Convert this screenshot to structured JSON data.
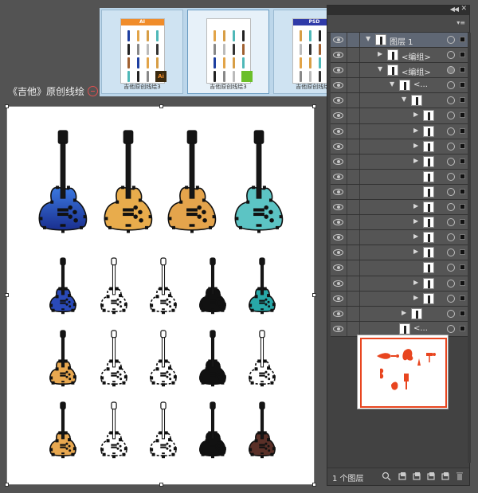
{
  "document": {
    "artboard_title": "《吉他》原创线绘"
  },
  "thumbnails": [
    {
      "label": "吉他原创线绘3",
      "header_text": "AI",
      "header_color": "#f08c2a",
      "badge": "Ai",
      "badge_color": "#f08c2a",
      "selected": false
    },
    {
      "label": "吉他原创线绘3",
      "header_text": "",
      "header_color": "#ffffff",
      "badge": "",
      "badge_color": "#6bbf2a",
      "selected": true
    },
    {
      "label": "吉他原创线绘3",
      "header_text": "PSD",
      "header_color": "#2f3aa8",
      "badge": "",
      "badge_color": "#c93ad0",
      "selected": false
    }
  ],
  "layers_panel": {
    "rows": [
      {
        "name": "图层 1",
        "indent": 0,
        "expanded": true,
        "has_twisty": true,
        "top": true,
        "full_target": false
      },
      {
        "name": "<编组>",
        "indent": 1,
        "expanded": false,
        "has_twisty": true,
        "top": false,
        "full_target": false
      },
      {
        "name": "<编组>",
        "indent": 1,
        "expanded": true,
        "has_twisty": true,
        "top": false,
        "full_target": true
      },
      {
        "name": "<...",
        "indent": 2,
        "expanded": true,
        "has_twisty": true,
        "top": false,
        "full_target": false
      },
      {
        "name": "",
        "indent": 3,
        "expanded": true,
        "has_twisty": true,
        "top": false,
        "full_target": false
      },
      {
        "name": "",
        "indent": 4,
        "expanded": false,
        "has_twisty": true,
        "top": false,
        "full_target": false
      },
      {
        "name": "",
        "indent": 4,
        "expanded": false,
        "has_twisty": true,
        "top": false,
        "full_target": false
      },
      {
        "name": "",
        "indent": 4,
        "expanded": false,
        "has_twisty": true,
        "top": false,
        "full_target": false
      },
      {
        "name": "",
        "indent": 4,
        "expanded": false,
        "has_twisty": true,
        "top": false,
        "full_target": false
      },
      {
        "name": "",
        "indent": 4,
        "expanded": false,
        "has_twisty": false,
        "top": false,
        "full_target": false
      },
      {
        "name": "",
        "indent": 4,
        "expanded": false,
        "has_twisty": false,
        "top": false,
        "full_target": false
      },
      {
        "name": "",
        "indent": 4,
        "expanded": false,
        "has_twisty": true,
        "top": false,
        "full_target": false
      },
      {
        "name": "",
        "indent": 4,
        "expanded": false,
        "has_twisty": true,
        "top": false,
        "full_target": false
      },
      {
        "name": "",
        "indent": 4,
        "expanded": false,
        "has_twisty": true,
        "top": false,
        "full_target": false
      },
      {
        "name": "",
        "indent": 4,
        "expanded": false,
        "has_twisty": true,
        "top": false,
        "full_target": false
      },
      {
        "name": "",
        "indent": 4,
        "expanded": false,
        "has_twisty": false,
        "top": false,
        "full_target": false
      },
      {
        "name": "",
        "indent": 4,
        "expanded": false,
        "has_twisty": true,
        "top": false,
        "full_target": false
      },
      {
        "name": "",
        "indent": 4,
        "expanded": false,
        "has_twisty": true,
        "top": false,
        "full_target": false
      },
      {
        "name": "",
        "indent": 3,
        "expanded": false,
        "has_twisty": true,
        "top": false,
        "full_target": false
      },
      {
        "name": "<...",
        "indent": 2,
        "expanded": false,
        "has_twisty": false,
        "top": false,
        "full_target": false
      }
    ],
    "layer_count": "1 个图层",
    "footer_icons": [
      "search-icon",
      "locate-object-icon",
      "make-clip-mask-icon",
      "new-sublayer-icon",
      "new-layer-icon",
      "delete-icon"
    ]
  },
  "guitar_colors": {
    "big": [
      "#2a56c8",
      "#e8ac4c",
      "#e4a44c",
      "#5cc4c4"
    ],
    "rows": [
      [
        "#2a4ab8",
        "none",
        "none",
        "#111111",
        "#28a8a8"
      ],
      [
        "#e8a850",
        "none",
        "none",
        "#111111",
        "none"
      ],
      [
        "#e8a850",
        "none",
        "none",
        "#111111",
        "#5a3028"
      ]
    ]
  },
  "preview_color": "#e8451f"
}
